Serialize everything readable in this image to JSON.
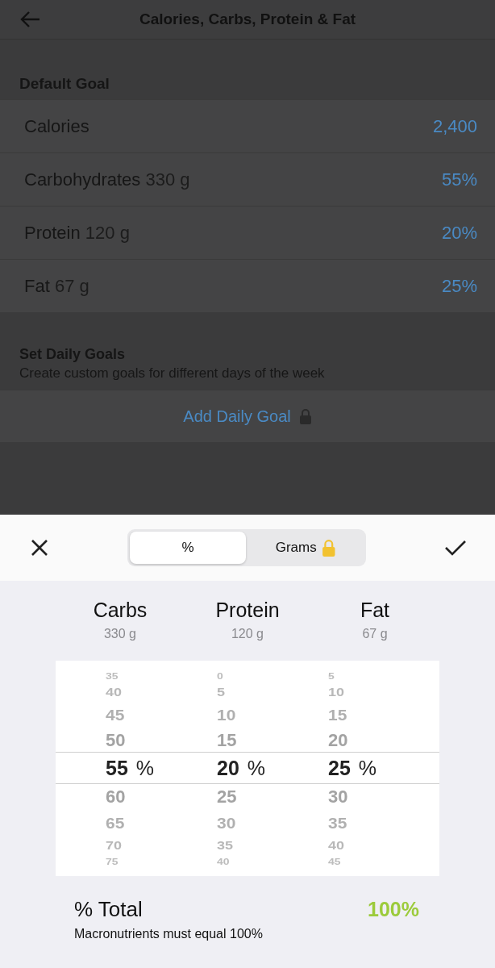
{
  "header": {
    "title": "Calories, Carbs, Protein & Fat"
  },
  "default_goal": {
    "title": "Default Goal",
    "rows": [
      {
        "label": "Calories",
        "value": "2,400"
      },
      {
        "label": "Carbohydrates",
        "detail": "330 g",
        "value": "55%"
      },
      {
        "label": "Protein",
        "detail": "120 g",
        "value": "20%"
      },
      {
        "label": "Fat",
        "detail": "67 g",
        "value": "25%"
      }
    ]
  },
  "daily_goals": {
    "title": "Set Daily Goals",
    "subtitle": "Create custom goals for different days of the week",
    "button": {
      "label": "Add Daily Goal",
      "locked": true
    }
  },
  "sheet": {
    "segments": [
      {
        "label": "%",
        "selected": true,
        "locked": false
      },
      {
        "label": "Grams",
        "selected": false,
        "locked": true
      }
    ],
    "columns": [
      {
        "label": "Carbs",
        "grams": "330 g",
        "unit": "%",
        "values": [
          {
            "text": "35",
            "selected": false
          },
          {
            "text": "40",
            "selected": false
          },
          {
            "text": "45",
            "selected": false
          },
          {
            "text": "50",
            "selected": false
          },
          {
            "text": "55",
            "selected": true
          },
          {
            "text": "60",
            "selected": false
          },
          {
            "text": "65",
            "selected": false
          },
          {
            "text": "70",
            "selected": false
          },
          {
            "text": "75",
            "selected": false
          }
        ]
      },
      {
        "label": "Protein",
        "grams": "120 g",
        "unit": "%",
        "values": [
          {
            "text": "0",
            "selected": false
          },
          {
            "text": "5",
            "selected": false
          },
          {
            "text": "10",
            "selected": false
          },
          {
            "text": "15",
            "selected": false
          },
          {
            "text": "20",
            "selected": true
          },
          {
            "text": "25",
            "selected": false
          },
          {
            "text": "30",
            "selected": false
          },
          {
            "text": "35",
            "selected": false
          },
          {
            "text": "40",
            "selected": false
          }
        ]
      },
      {
        "label": "Fat",
        "grams": "67 g",
        "unit": "%",
        "values": [
          {
            "text": "5",
            "selected": false
          },
          {
            "text": "10",
            "selected": false
          },
          {
            "text": "15",
            "selected": false
          },
          {
            "text": "20",
            "selected": false
          },
          {
            "text": "25",
            "selected": true
          },
          {
            "text": "30",
            "selected": false
          },
          {
            "text": "35",
            "selected": false
          },
          {
            "text": "40",
            "selected": false
          },
          {
            "text": "45",
            "selected": false
          }
        ]
      }
    ],
    "total": {
      "label": "% Total",
      "value": "100%",
      "note": "Macronutrients must equal 100%"
    }
  }
}
